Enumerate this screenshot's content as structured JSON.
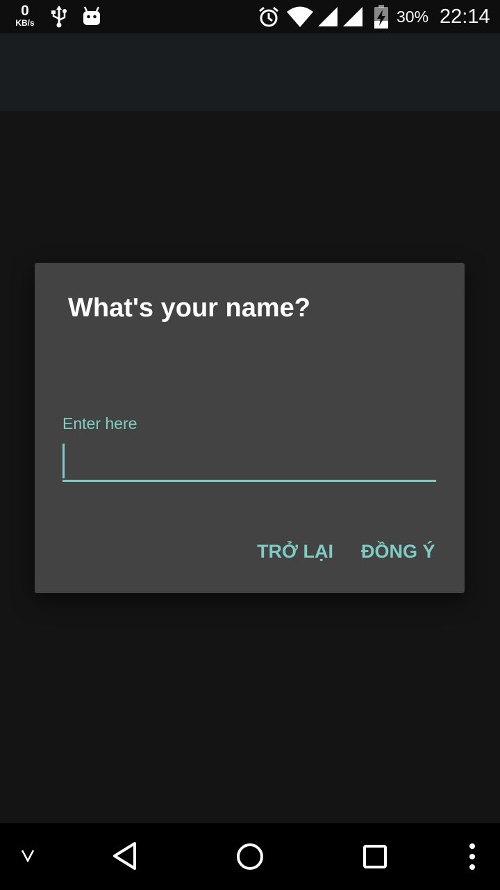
{
  "status_bar": {
    "net_speed_value": "0",
    "net_speed_unit": "KB/s",
    "battery_percent": "30%",
    "time": "22:14",
    "icons": [
      "usb-icon",
      "android-debug-icon",
      "alarm-icon",
      "wifi-icon",
      "signal-icon",
      "signal-icon-2",
      "battery-charging-icon"
    ]
  },
  "dialog": {
    "title": "What's your name?",
    "field": {
      "label": "Enter here",
      "value": ""
    },
    "buttons": {
      "back_label": "TRỞ LẠI",
      "ok_label": "ĐỒNG Ý"
    }
  },
  "nav_bar": {
    "icons": [
      "chevron-down-icon",
      "back-icon",
      "home-icon",
      "recents-icon",
      "more-vert-icon"
    ]
  },
  "colors": {
    "accent": "#80cbc4",
    "dialog_background": "#434343",
    "screen_background": "#141414"
  }
}
